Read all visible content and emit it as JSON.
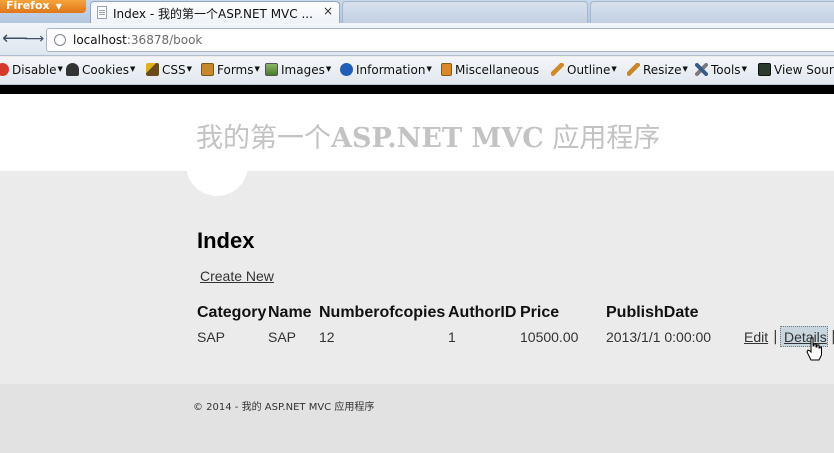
{
  "browser": {
    "app_button": "Firefox",
    "tab": {
      "title": "Index - 我的第一个ASP.NET MVC ...",
      "close": "×"
    },
    "url": {
      "host": "localhost",
      "rest": ":36878/book"
    },
    "nav": {
      "back": "⟵",
      "forward": "⟶"
    }
  },
  "devtoolbar": {
    "items": [
      {
        "label": "Disable",
        "icon": "disable-icon",
        "color": "#d43a2a"
      },
      {
        "label": "Cookies",
        "icon": "cookies-icon",
        "color": "#333333"
      },
      {
        "label": "CSS",
        "icon": "css-wand-icon",
        "color": "#e0b020"
      },
      {
        "label": "Forms",
        "icon": "forms-icon",
        "color": "#c8872a"
      },
      {
        "label": "Images",
        "icon": "images-icon",
        "color": "#5a8a3a"
      },
      {
        "label": "Information",
        "icon": "information-icon",
        "color": "#1f5fb5"
      },
      {
        "label": "Miscellaneous",
        "icon": "miscellaneous-icon",
        "color": "#d9892a"
      },
      {
        "label": "Outline",
        "icon": "outline-pencil-icon",
        "color": "#d08a2a"
      },
      {
        "label": "Resize",
        "icon": "resize-pencil-icon",
        "color": "#c8872a"
      },
      {
        "label": "Tools",
        "icon": "tools-icon",
        "color": "#3a5a8a"
      },
      {
        "label": "View Sour",
        "icon": "view-source-icon",
        "color": "#2c3a2c"
      }
    ]
  },
  "site": {
    "title_prefix": "我的第一个",
    "title_bold": "ASP.NET MVC",
    "title_suffix": " 应用程序"
  },
  "page": {
    "heading": "Index",
    "create_link": "Create New",
    "columns": [
      "Category",
      "Name",
      "Numberofcopies",
      "AuthorID",
      "Price",
      "PublishDate"
    ],
    "rows": [
      {
        "category": "SAP",
        "name": "SAP",
        "copies": "12",
        "author_id": "1",
        "price": "10500.00",
        "publish_date": "2013/1/1 0:00:00",
        "edit": "Edit",
        "details": "Details",
        "sep": "|"
      }
    ]
  },
  "footer": {
    "text": "© 2014 - 我的 ASP.NET MVC 应用程序"
  }
}
